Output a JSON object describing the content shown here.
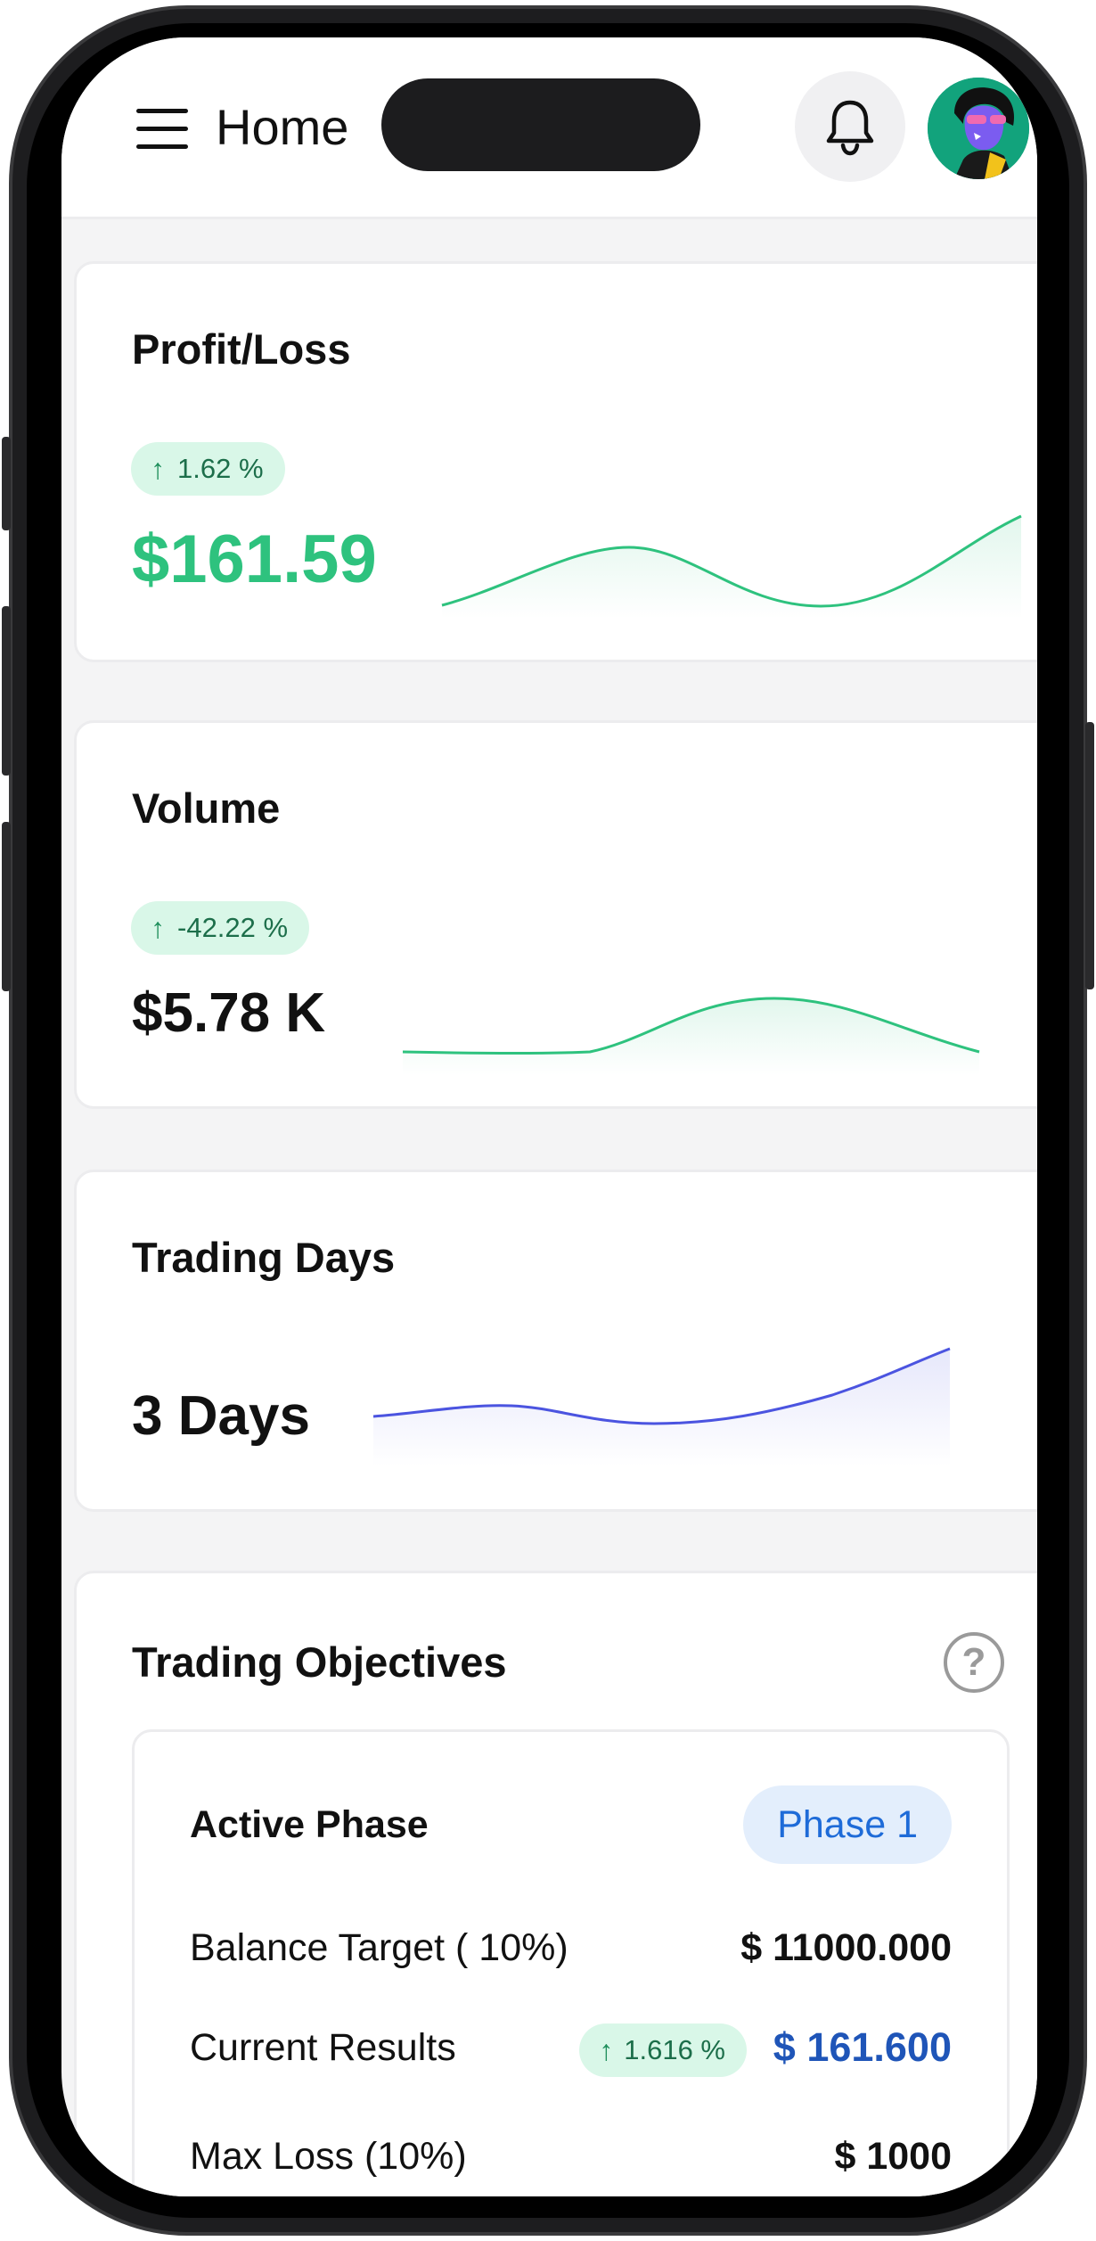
{
  "header": {
    "title": "Home",
    "menu_icon": "hamburger-menu-icon",
    "bell_icon": "bell-icon",
    "avatar_icon": "user-avatar"
  },
  "colors": {
    "positive": "#2ec27e",
    "neutral_line": "#4b54e0",
    "link_blue": "#1f55b8",
    "phase_bg": "#e3eefc"
  },
  "cards": {
    "profit_loss": {
      "title": "Profit/Loss",
      "change": "1.62 %",
      "value": "$161.59"
    },
    "volume": {
      "title": "Volume",
      "change": "-42.22 %",
      "value": "$5.78 K"
    },
    "trading_days": {
      "title": "Trading Days",
      "value": "3 Days"
    }
  },
  "objectives": {
    "title": "Trading Objectives",
    "help_icon": "question-mark-icon",
    "active_phase_label": "Active Phase",
    "active_phase_value": "Phase 1",
    "balance_target_label": "Balance Target ( 10%)",
    "balance_target_value": "$ 11000.000",
    "current_results_label": "Current Results",
    "current_results_change": "1.616 %",
    "current_results_value": "$ 161.600",
    "max_loss_label": "Max Loss (10%)",
    "max_loss_value": "$ 1000"
  }
}
